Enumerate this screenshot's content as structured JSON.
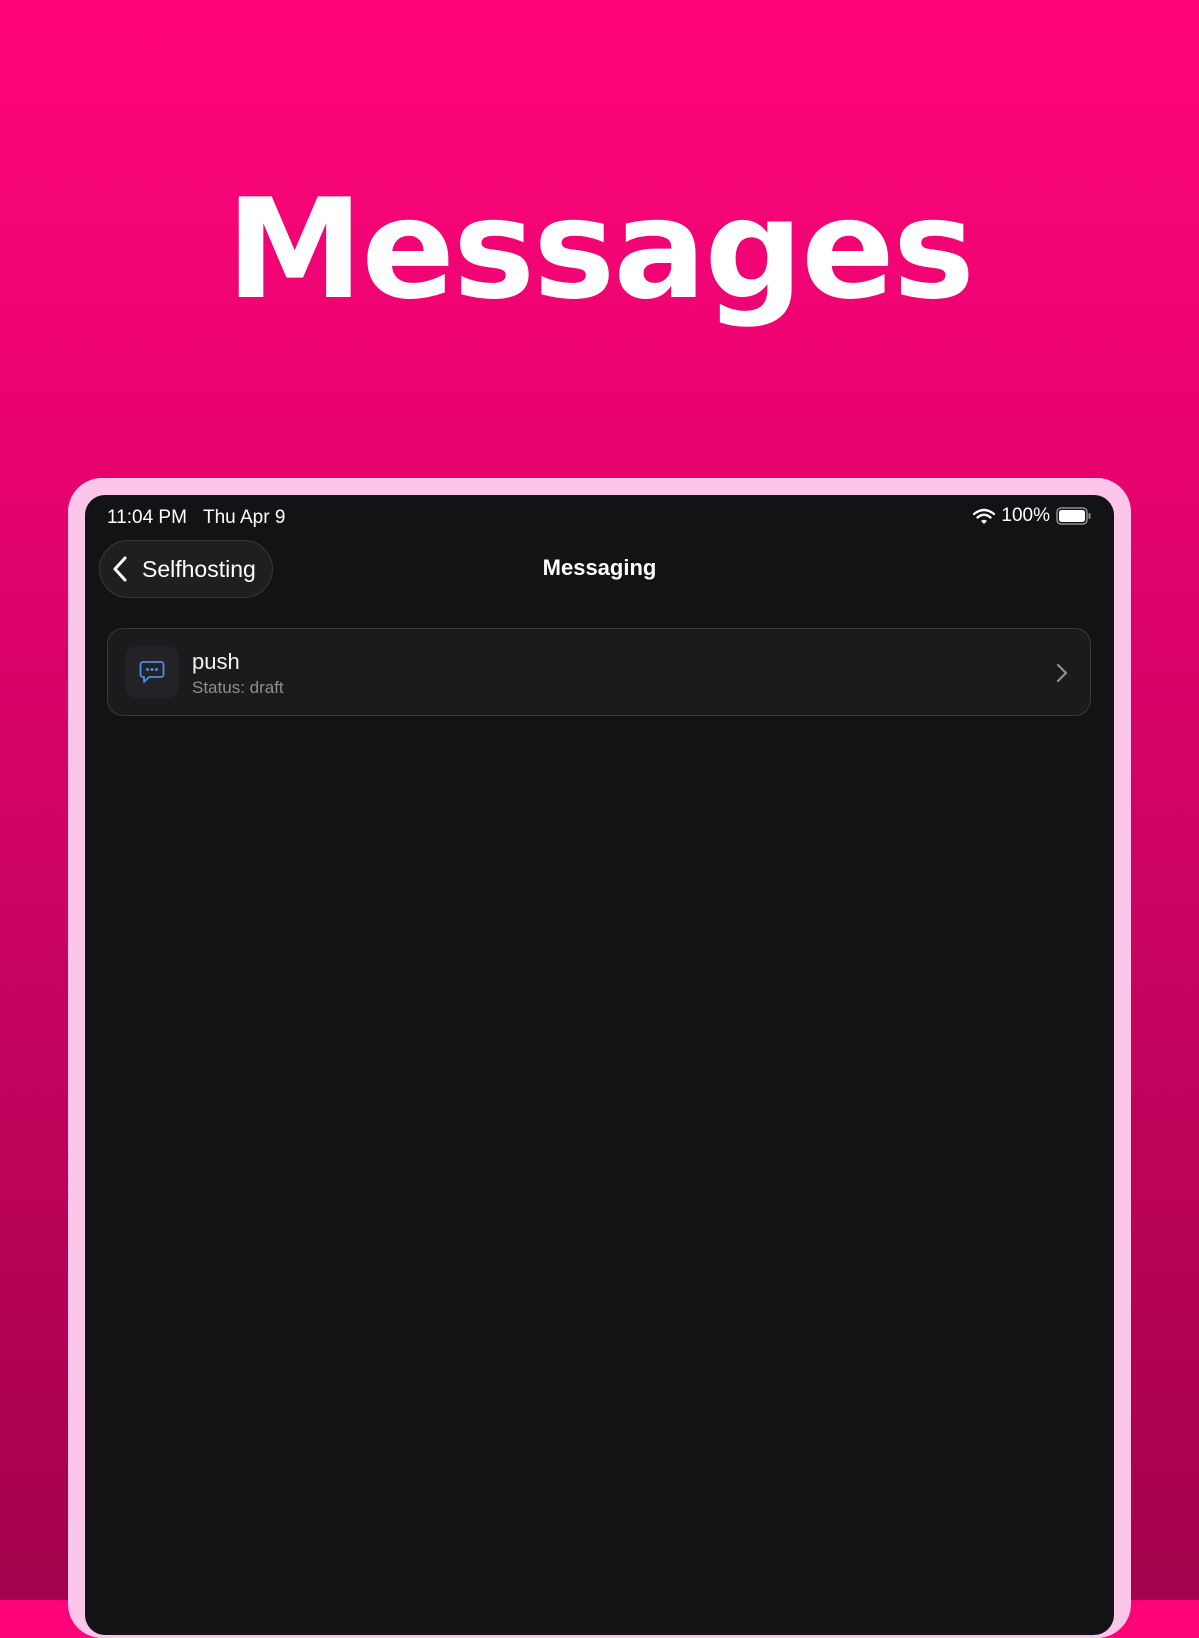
{
  "headline": "Messages",
  "status_bar": {
    "time": "11:04 PM",
    "date": "Thu Apr 9",
    "battery": "100%"
  },
  "nav": {
    "back_label": "Selfhosting",
    "title": "Messaging"
  },
  "messages": [
    {
      "name": "push",
      "status": "Status: draft",
      "icon": "chat-bubble-icon"
    }
  ],
  "colors": {
    "background_top": "#ff0479",
    "background_bottom": "#a3024d",
    "frame": "#fcc6ea",
    "screen": "#131315",
    "icon_accent": "#4a8fe0"
  }
}
